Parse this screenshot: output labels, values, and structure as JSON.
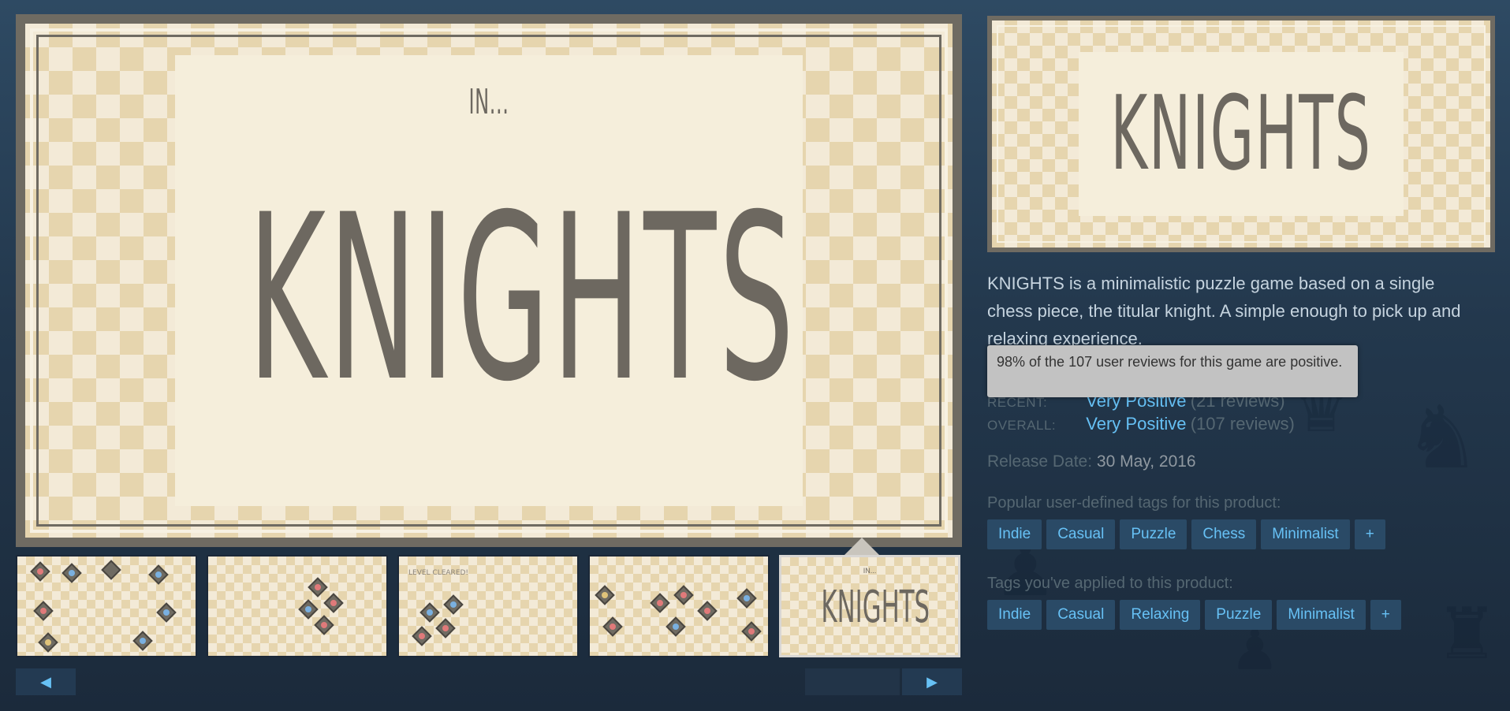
{
  "main_screenshot": {
    "small_text": "IN...",
    "title": "KNIGHTS"
  },
  "thumbnails": [
    {
      "caption": ""
    },
    {
      "caption": ""
    },
    {
      "caption": "LEVEL CLEARED!"
    },
    {
      "caption": ""
    },
    {
      "caption_small": "IN...",
      "caption_title": "KNIGHTS",
      "selected": true
    }
  ],
  "slider": {
    "left_arrow": "◀",
    "right_arrow": "▶"
  },
  "capsule": {
    "title": "KNIGHTS"
  },
  "description": "KNIGHTS is a minimalistic puzzle game based on a single chess piece, the titular knight. A simple enough to pick up and relaxing experience.",
  "tooltip": "98% of the 107 user reviews for this game are positive.",
  "reviews": {
    "recent": {
      "label": "RECENT:",
      "summary": "Very Positive",
      "count": "(21 reviews)"
    },
    "overall": {
      "label": "OVERALL:",
      "summary": "Very Positive",
      "count": "(107 reviews)"
    }
  },
  "release": {
    "label": "Release Date:",
    "value": "30 May, 2016"
  },
  "popular_tags": {
    "heading": "Popular user-defined tags for this product:",
    "tags": [
      "Indie",
      "Casual",
      "Puzzle",
      "Chess",
      "Minimalist",
      "+"
    ]
  },
  "applied_tags": {
    "heading": "Tags you've applied to this product:",
    "tags": [
      "Indie",
      "Casual",
      "Relaxing",
      "Puzzle",
      "Minimalist",
      "+"
    ]
  },
  "colors": {
    "accent": "#66c0f4",
    "tag_bg": "#2a4a66",
    "muted": "#556772",
    "board_light": "#f3ead7",
    "board_dark": "#e6d5ae",
    "ink": "#6d6860"
  }
}
